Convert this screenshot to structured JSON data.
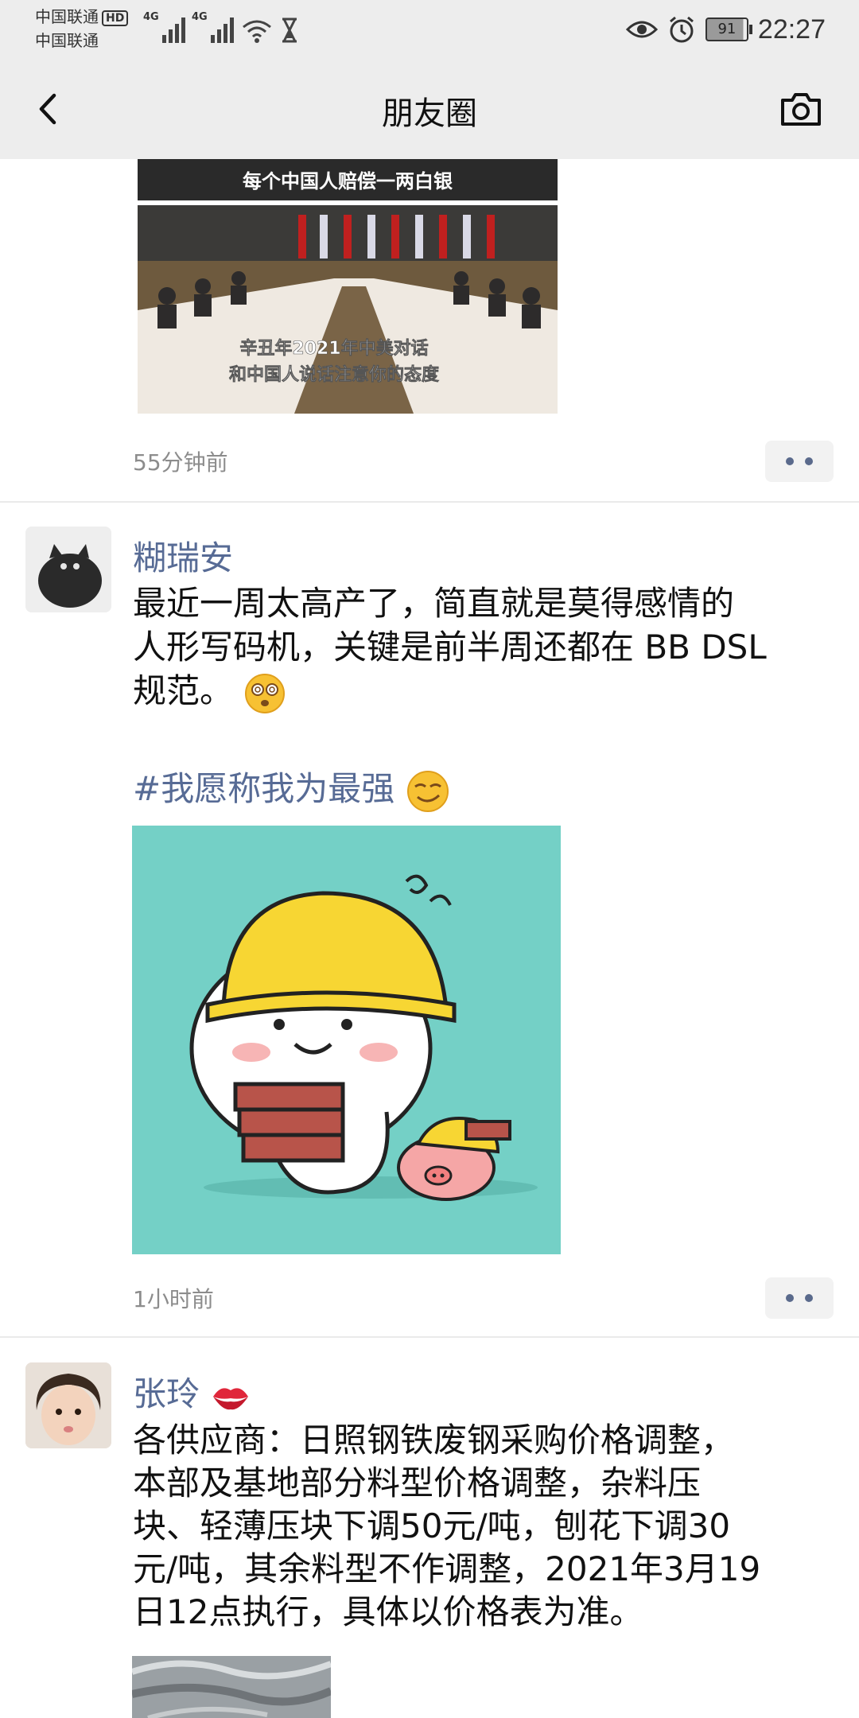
{
  "status_bar": {
    "carrier1": "中国联通",
    "carrier2": "中国联通",
    "hd_badge": "HD",
    "net1": "4G",
    "net2": "4G",
    "battery": "91",
    "time": "22:27"
  },
  "nav": {
    "title": "朋友圈"
  },
  "posts": [
    {
      "image_caption_top": "每个中国人赔偿一两白银",
      "image_caption_line1": "辛丑年2021年中美对话",
      "image_caption_line2": "和中国人说话注意你的态度",
      "time": "55分钟前"
    },
    {
      "name": "糊瑞安",
      "text_line1": "最近一周太高产了，简直就是莫得感情的",
      "text_line2": "人形写码机，关键是前半周还都在 BB DSL",
      "text_line3": "规范。",
      "hashtag": "#我愿称我为最强",
      "time": "1小时前"
    },
    {
      "name": "张玲",
      "text_line1": "各供应商：日照钢铁废钢采购价格调整，",
      "text_line2": "本部及基地部分料型价格调整，杂料压",
      "text_line3": "块、轻薄压块下调50元/吨，刨花下调30",
      "text_line4": "元/吨，其余料型不作调整，2021年3月19",
      "text_line5": "日12点执行，具体以价格表为准。"
    }
  ],
  "colors": {
    "bar_bg": "#ededed",
    "link": "#576b95",
    "time": "#8c8c8c"
  }
}
